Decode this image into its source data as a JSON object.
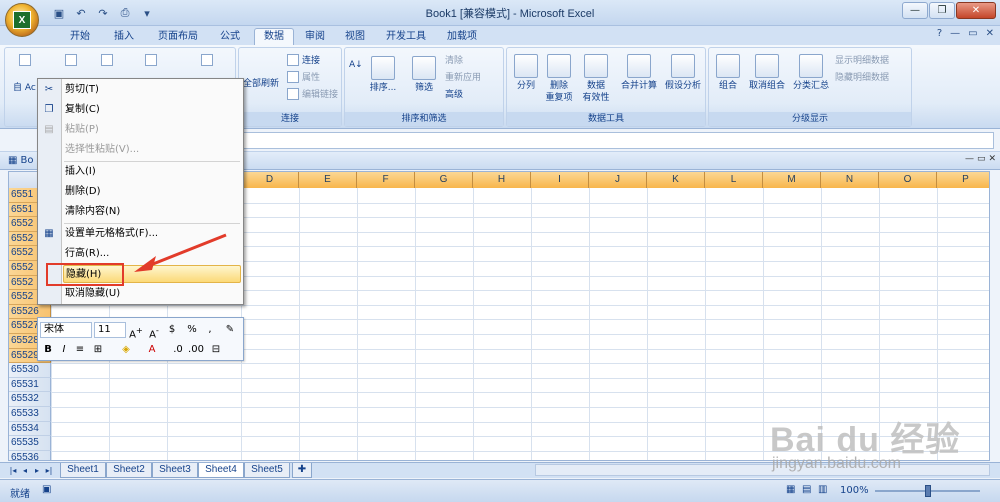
{
  "window": {
    "title": "Book1  [兼容模式] - Microsoft Excel"
  },
  "ribbon_tabs": [
    "开始",
    "插入",
    "页面布局",
    "公式",
    "数据",
    "审阅",
    "视图",
    "开发工具",
    "加载项"
  ],
  "active_tab": "数据",
  "ribbon": {
    "get_external": {
      "label": "自 Ac"
    },
    "connections": {
      "refresh_all": "全部刷新",
      "connections": "连接",
      "properties": "属性",
      "edit_links": "编辑链接",
      "group_label": "连接"
    },
    "sort_filter": {
      "sort": "排序...",
      "filter": "筛选",
      "clear": "清除",
      "reapply": "重新应用",
      "advanced": "高级",
      "group_label": "排序和筛选"
    },
    "data_tools": {
      "text_to_columns": "分列",
      "remove_dup_1": "删除",
      "remove_dup_2": "重复项",
      "validation_1": "数据",
      "validation_2": "有效性",
      "consolidate": "合并计算",
      "whatif": "假设分析",
      "group_label": "数据工具"
    },
    "outline": {
      "group": "组合",
      "ungroup": "取消组合",
      "subtotal": "分类汇总",
      "show_detail": "显示明细数据",
      "hide_detail": "隐藏明细数据",
      "group_label": "分级显示"
    }
  },
  "workbook": {
    "title": "Bo"
  },
  "columns": [
    "D",
    "E",
    "F",
    "G",
    "H",
    "I",
    "J",
    "K",
    "L",
    "M",
    "N",
    "O",
    "P"
  ],
  "rows": [
    "6551",
    "6551",
    "6552",
    "6552",
    "6552",
    "6552",
    "6552",
    "6552",
    "65526",
    "65527",
    "65528",
    "65529",
    "65530",
    "65531",
    "65532",
    "65533",
    "65534",
    "65535",
    "65536"
  ],
  "context_menu": {
    "items": [
      {
        "label": "剪切(T)",
        "enabled": true,
        "icon": "scissors-icon"
      },
      {
        "label": "复制(C)",
        "enabled": true,
        "icon": "copy-icon"
      },
      {
        "label": "粘贴(P)",
        "enabled": false,
        "icon": "paste-icon"
      },
      {
        "label": "选择性粘贴(V)...",
        "enabled": false,
        "icon": ""
      },
      {
        "label": "插入(I)",
        "enabled": true,
        "icon": ""
      },
      {
        "label": "删除(D)",
        "enabled": true,
        "icon": ""
      },
      {
        "label": "清除内容(N)",
        "enabled": true,
        "icon": ""
      },
      {
        "label": "设置单元格格式(F)...",
        "enabled": true,
        "icon": "format-cells-icon"
      },
      {
        "label": "行高(R)...",
        "enabled": true,
        "icon": ""
      },
      {
        "label": "隐藏(H)",
        "enabled": true,
        "icon": "",
        "highlighted": true
      },
      {
        "label": "取消隐藏(U)",
        "enabled": true,
        "icon": ""
      }
    ]
  },
  "mini_toolbar": {
    "font": "宋体",
    "size": "11"
  },
  "sheet_tabs": [
    "Sheet1",
    "Sheet2",
    "Sheet3",
    "Sheet4",
    "Sheet5"
  ],
  "active_sheet": "Sheet4",
  "status": {
    "text": "就绪",
    "zoom": "100%"
  },
  "watermark": {
    "brand": "Bai du 经验",
    "url": "jingyan.baidu.com"
  },
  "colors": {
    "highlight_box": "#e23b2a",
    "header_selected": "#f8b64c"
  }
}
